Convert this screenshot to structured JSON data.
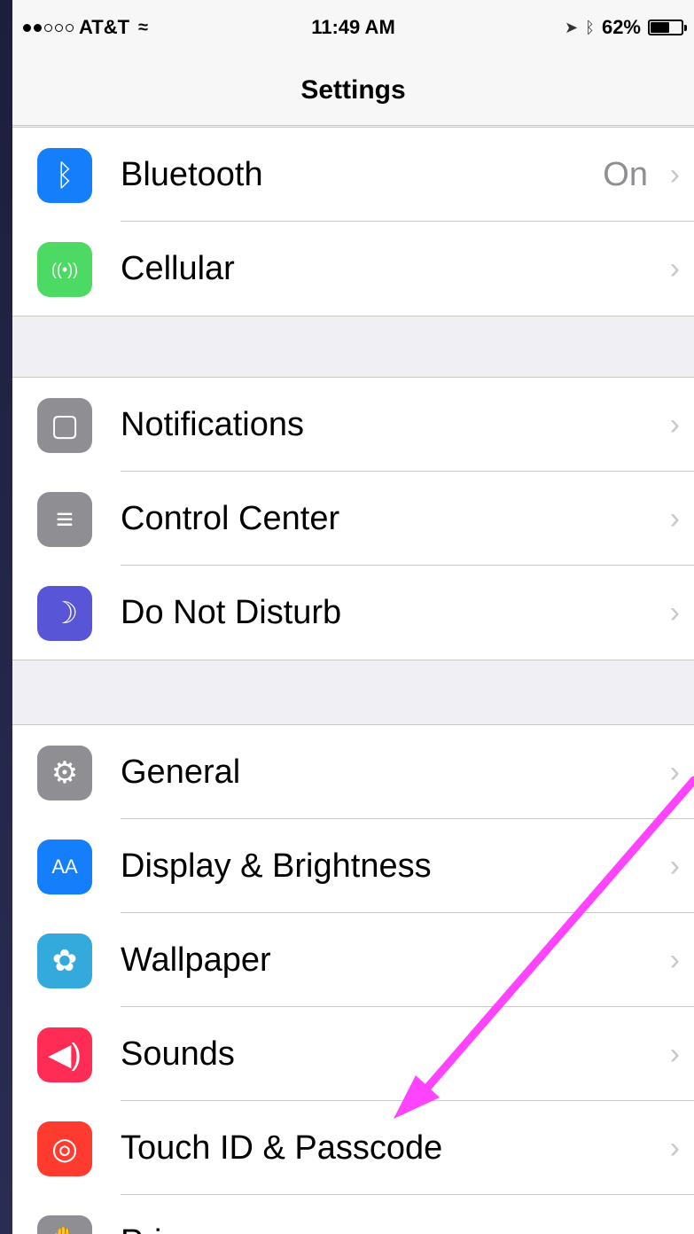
{
  "status_bar": {
    "carrier": "AT&T",
    "time": "11:49 AM",
    "battery": "62%",
    "battery_level": 0.62,
    "signal_dots_filled": 2,
    "signal_dots_total": 5,
    "icons": [
      "wifi-icon",
      "location-arrow-icon",
      "bluetooth-icon",
      "battery-icon"
    ]
  },
  "nav": {
    "title": "Settings"
  },
  "groups": [
    {
      "rows": [
        {
          "label": "Bluetooth",
          "detail": "On",
          "icon": "bluetooth-icon",
          "color": "#147efb",
          "glyph": "ᛒ"
        },
        {
          "label": "Cellular",
          "detail": "",
          "icon": "cellular-antenna-icon",
          "color": "#4cd964",
          "glyph": "((•))"
        }
      ]
    },
    {
      "rows": [
        {
          "label": "Notifications",
          "detail": "",
          "icon": "notifications-icon",
          "color": "#8e8e93",
          "glyph": "▢"
        },
        {
          "label": "Control Center",
          "detail": "",
          "icon": "control-center-icon",
          "color": "#8e8e93",
          "glyph": "≡"
        },
        {
          "label": "Do Not Disturb",
          "detail": "",
          "icon": "moon-icon",
          "color": "#5856d6",
          "glyph": "☽"
        }
      ]
    },
    {
      "rows": [
        {
          "label": "General",
          "detail": "",
          "icon": "gear-icon",
          "color": "#8e8e93",
          "glyph": "⚙"
        },
        {
          "label": "Display & Brightness",
          "detail": "",
          "icon": "display-brightness-icon",
          "color": "#147efb",
          "glyph": "AA"
        },
        {
          "label": "Wallpaper",
          "detail": "",
          "icon": "wallpaper-flower-icon",
          "color": "#34aadc",
          "glyph": "✿"
        },
        {
          "label": "Sounds",
          "detail": "",
          "icon": "speaker-icon",
          "color": "#ff2d55",
          "glyph": "◀)"
        },
        {
          "label": "Touch ID & Passcode",
          "detail": "",
          "icon": "fingerprint-icon",
          "color": "#ff3b30",
          "glyph": "◎"
        },
        {
          "label": "Privacy",
          "detail": "",
          "icon": "privacy-hand-icon",
          "color": "#8e8e93",
          "glyph": "✋"
        }
      ]
    }
  ],
  "annotation": {
    "color": "#ff44ff",
    "points_to": "Touch ID & Passcode"
  }
}
